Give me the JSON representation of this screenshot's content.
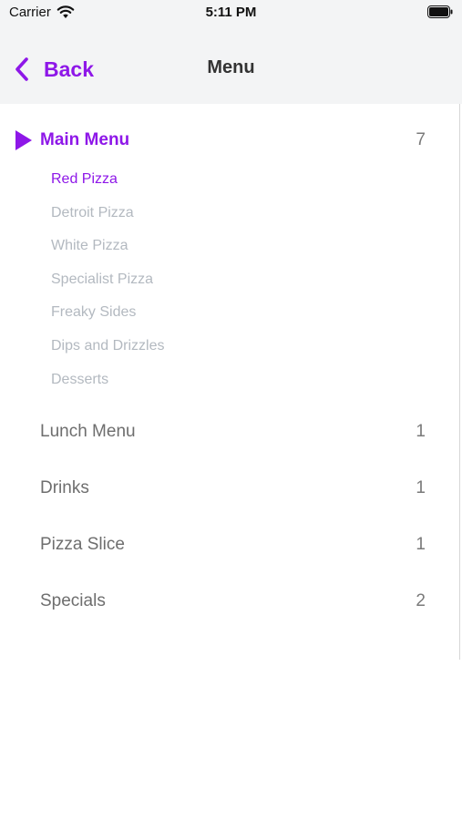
{
  "status_bar": {
    "carrier": "Carrier",
    "time": "5:11 PM"
  },
  "nav": {
    "back_label": "Back",
    "title": "Menu"
  },
  "colors": {
    "accent": "#8e17e8",
    "subitem_inactive": "#b3b9c0",
    "category_text": "#6e6e6e",
    "bar_bg": "#f3f4f5"
  },
  "menu": {
    "categories": [
      {
        "label": "Main Menu",
        "count": "7",
        "expanded": true,
        "items": [
          {
            "label": "Red Pizza",
            "selected": true
          },
          {
            "label": "Detroit Pizza",
            "selected": false
          },
          {
            "label": "White Pizza",
            "selected": false
          },
          {
            "label": "Specialist Pizza",
            "selected": false
          },
          {
            "label": "Freaky Sides",
            "selected": false
          },
          {
            "label": "Dips and Drizzles",
            "selected": false
          },
          {
            "label": "Desserts",
            "selected": false
          }
        ]
      },
      {
        "label": "Lunch Menu",
        "count": "1",
        "expanded": false
      },
      {
        "label": "Drinks",
        "count": "1",
        "expanded": false
      },
      {
        "label": "Pizza Slice",
        "count": "1",
        "expanded": false
      },
      {
        "label": "Specials",
        "count": "2",
        "expanded": false
      }
    ]
  }
}
